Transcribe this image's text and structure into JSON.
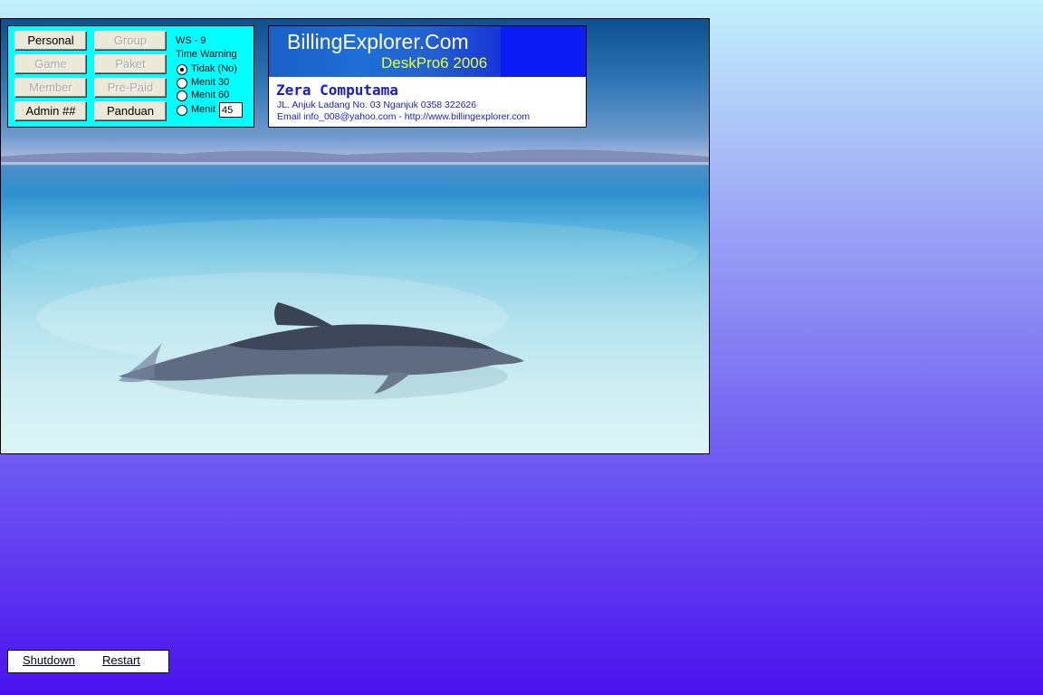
{
  "panel": {
    "buttons": [
      {
        "label": "Personal",
        "enabled": true
      },
      {
        "label": "Group",
        "enabled": false
      },
      {
        "label": "Game",
        "enabled": false
      },
      {
        "label": "Paket",
        "enabled": false
      },
      {
        "label": "Member",
        "enabled": false
      },
      {
        "label": "Pre-Paid",
        "enabled": false
      },
      {
        "label": "Admin ##",
        "enabled": true
      },
      {
        "label": "Panduan",
        "enabled": true
      }
    ],
    "ws_label": "WS - 9",
    "time_warning_label": "Time Warning",
    "radios": [
      {
        "label": "Tidak (No)",
        "checked": true
      },
      {
        "label": "Menit  30",
        "checked": false
      },
      {
        "label": "Menit  60",
        "checked": false
      },
      {
        "label": "Menit",
        "checked": false
      }
    ],
    "custom_minutes_value": "45"
  },
  "info": {
    "banner_title": "BillingExplorer.Com",
    "banner_subtitle": "DeskPro6 2006",
    "company": "Zera Computama",
    "address": "JL. Anjuk Ladang No. 03 Nganjuk 0358 322626",
    "email": "Email info_008@yahoo.com - http://www.billingexplorer.com"
  },
  "bottom": {
    "shutdown_label": "Shutdown",
    "restart_label": "Restart"
  },
  "colors": {
    "panel_bg": "#00ffff",
    "banner_bg": "#0b1cf5",
    "company_text": "#1a1adc"
  }
}
